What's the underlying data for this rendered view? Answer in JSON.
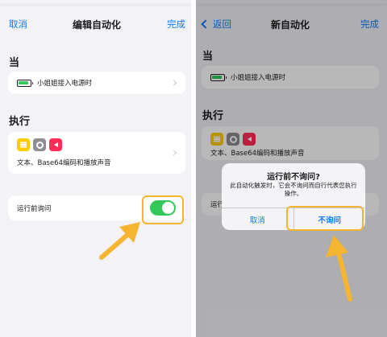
{
  "left": {
    "nav": {
      "cancel": "取消",
      "title": "编辑自动化",
      "done": "完成"
    },
    "when_header": "当",
    "trigger_text": "小姐姐接入电源时",
    "do_header": "执行",
    "actions_text": "文本、Base64编码和播放声音",
    "ask_label": "运行前询问",
    "ask_enabled": true
  },
  "right": {
    "nav": {
      "back": "返回",
      "title": "新自动化",
      "done": "完成"
    },
    "when_header": "当",
    "trigger_text": "小姐姐接入电源时",
    "do_header": "执行",
    "actions_text": "文本、Base64编码和播放声音",
    "ask_label": "运行前询问",
    "alert": {
      "title": "运行前不询问?",
      "message": "此自动化触发时，它会不询问而自行代表您执行操作。",
      "cancel": "取消",
      "confirm": "不询问"
    }
  },
  "icons": [
    "battery-icon",
    "text-icon",
    "settings-icon",
    "sound-icon",
    "chevron-right-icon",
    "back-chevron-icon"
  ],
  "colors": {
    "accent": "#0a7cff",
    "toggle_on": "#34c759",
    "highlight": "#f5b530",
    "background": "#f2f2f7"
  }
}
